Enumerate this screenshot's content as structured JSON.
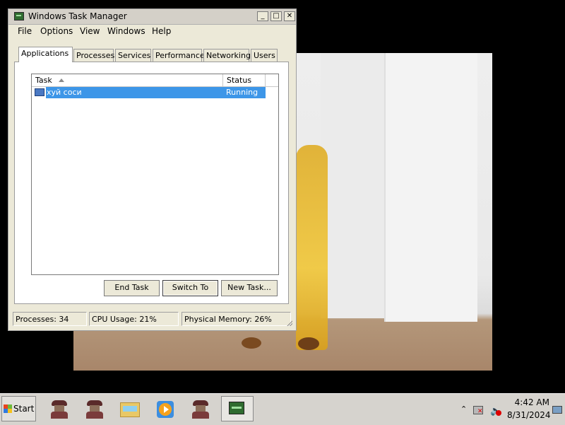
{
  "window": {
    "title": "Windows Task Manager",
    "controls": {
      "minimize": "_",
      "maximize": "□",
      "close": "✕"
    },
    "menu": [
      "File",
      "Options",
      "View",
      "Windows",
      "Help"
    ],
    "tabs": [
      "Applications",
      "Processes",
      "Services",
      "Performance",
      "Networking",
      "Users"
    ],
    "active_tab": "Applications",
    "list": {
      "columns": [
        "Task",
        "Status"
      ],
      "sort_column": "Task",
      "rows": [
        {
          "task": "хуй соси",
          "status": "Running",
          "selected": true
        }
      ]
    },
    "buttons": {
      "end_task": "End Task",
      "switch_to": "Switch To",
      "new_task": "New Task..."
    },
    "status_bar": {
      "processes": "Processes: 34",
      "cpu": "CPU Usage: 21%",
      "memory": "Physical Memory: 26%"
    }
  },
  "taskbar": {
    "start_label": "Start",
    "apps": [
      "spy-icon",
      "spy-icon",
      "explorer-icon",
      "media-player-icon",
      "spy-icon",
      "task-manager-icon"
    ],
    "tray": {
      "time": "4:42 AM",
      "date": "8/31/2024"
    }
  }
}
